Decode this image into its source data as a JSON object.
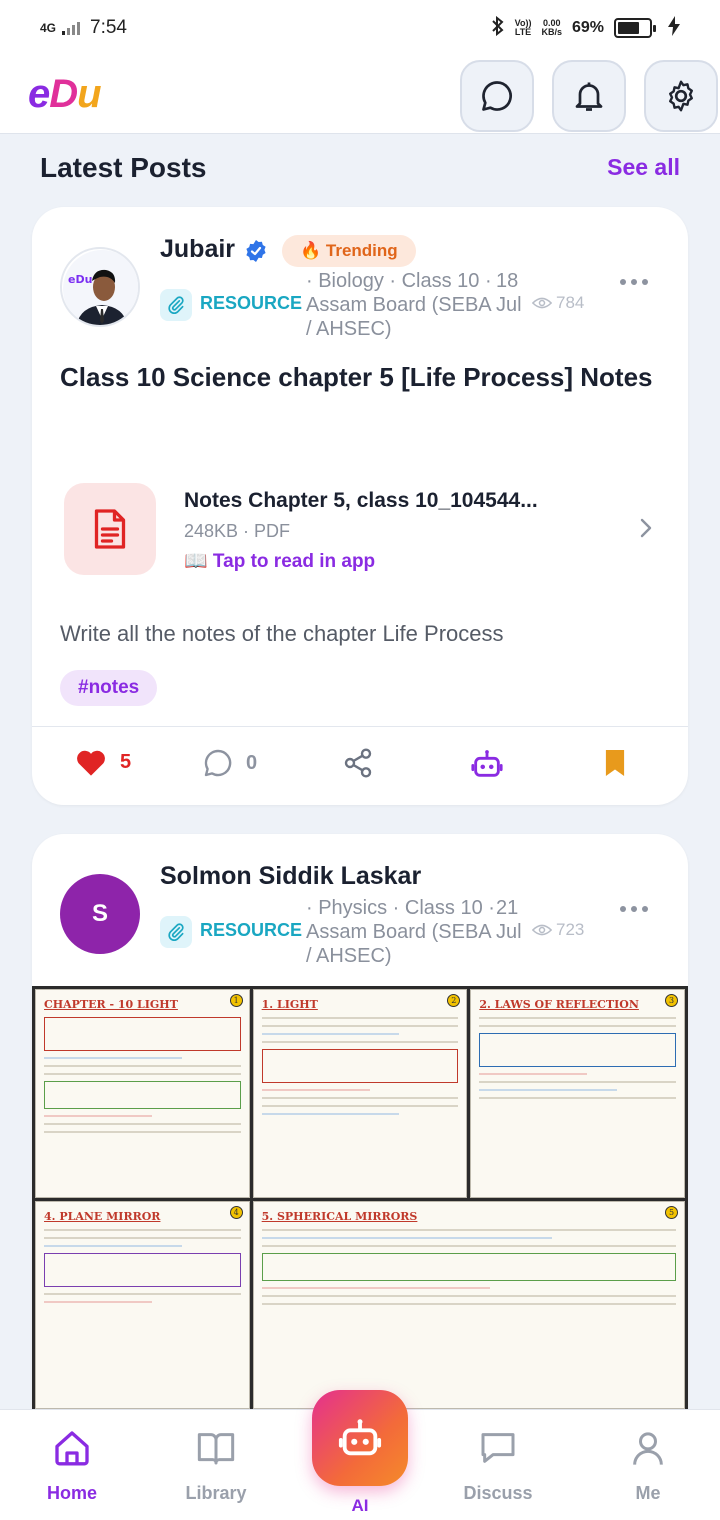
{
  "status_bar": {
    "network": "4G",
    "time": "7:54",
    "volte_top": "Vo))",
    "volte_bottom": "LTE",
    "speed_top": "0.00",
    "speed_bottom": "KB/s",
    "battery": "69%",
    "battery_level": 0.69
  },
  "header": {
    "logo": {
      "part1": "e",
      "part2": "D",
      "part3": "u"
    }
  },
  "section": {
    "title": "Latest Posts",
    "see_all": "See all"
  },
  "posts": [
    {
      "author": "Jubair",
      "verified": true,
      "badge": "🔥 Trending",
      "type": "RESOURCE",
      "meta": "· Biology · Class 10 · Assam Board (SEBA / AHSEC)",
      "date": "18 Jul",
      "views": "784",
      "title": "Class 10 Science chapter 5 [Life Process] Notes",
      "attachment": {
        "name": "Notes Chapter 5, class 10_104544...",
        "info": "248KB · PDF",
        "action": "📖 Tap to read in app"
      },
      "description": "Write all the notes of the chapter Life Process",
      "tag": "#notes",
      "likes": "5",
      "comments": "0"
    },
    {
      "author": "Solmon Siddik Laskar",
      "avatar_letter": "S",
      "type": "RESOURCE",
      "meta": "· Physics · Class 10 · Assam Board (SEBA / AHSEC)",
      "date": "21 Jul",
      "views": "723",
      "image_panels": [
        {
          "num": "1",
          "title": "CHAPTER - 10  LIGHT"
        },
        {
          "num": "2",
          "title": "1. LIGHT"
        },
        {
          "num": "3",
          "title": "2. LAWS OF REFLECTION"
        },
        {
          "num": "4",
          "title": "4. PLANE MIRROR"
        },
        {
          "num": "5",
          "title": "5. SPHERICAL MIRRORS"
        }
      ]
    }
  ],
  "nav": {
    "home": "Home",
    "library": "Library",
    "ai": "AI",
    "discuss": "Discuss",
    "me": "Me"
  },
  "colors": {
    "accent": "#8a2be2",
    "resource": "#1aa7c2",
    "like": "#e02424",
    "bookmark": "#e89a1c",
    "trending": "#e0651a"
  }
}
